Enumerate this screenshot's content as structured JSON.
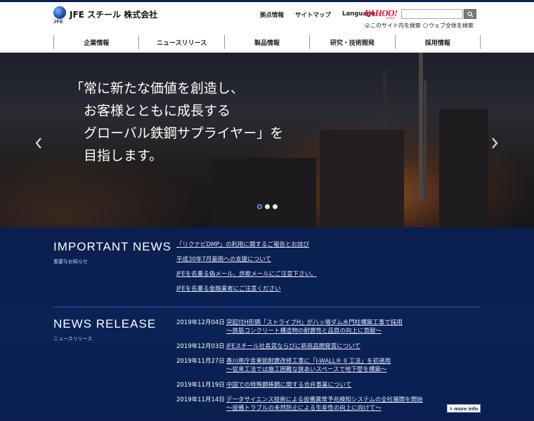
{
  "header": {
    "logo_text": "JFE",
    "company_name": "JFE スチール 株式会社",
    "util_links": [
      "拠点情報",
      "サイトマップ",
      "Language"
    ]
  },
  "search": {
    "yahoo_logo": "YAHOO!",
    "yahoo_sub": "JAPAN",
    "placeholder": "",
    "button_icon": "search-icon",
    "options": [
      "このサイト内を検索",
      "ウェブ全体を検索"
    ],
    "selected_option": "このサイト内を検索"
  },
  "nav": {
    "items": [
      "企業情報",
      "ニュースリリース",
      "製品情報",
      "研究・技術開発",
      "採用情報"
    ]
  },
  "hero": {
    "copy": "「常に新たな価値を創造し、\n　お客様とともに成長する\n　グローバル鉄鋼サプライヤー」を\n　目指します。",
    "slide_count": 3,
    "active_slide": 1
  },
  "important_news": {
    "title": "IMPORTANT NEWS",
    "subtitle": "重要なお知らせ",
    "items": [
      "「リクナビDMP」の利用に関するご報告とお詫び",
      "平成30年7月豪雨への支援について",
      "JFEを名乗る偽メール、詐欺メールにご注意下さい。",
      "JFEを名乗る金融業者にご注意ください"
    ]
  },
  "news_release": {
    "title": "NEWS RELEASE",
    "subtitle": "ニュースリリース",
    "items": [
      {
        "date": "2019年12月04日",
        "lines": [
          "突起付H形鋼「ストライプH」が八ッ場ダム水門柱構築工事で採用",
          "～鉄筋コンクリート構造物の耐震性と品質の向上に貢献～"
        ]
      },
      {
        "date": "2019年12月03日",
        "lines": [
          "JFEスチール社長賞ならびに新商品開発賞について"
        ]
      },
      {
        "date": "2019年11月27日",
        "lines": [
          "香川県庁舎東館耐震改修工事に「J-WALL® II 工法」を初適用",
          "～従来工法では施工困難な狭あいスペースで地下壁を構築～"
        ]
      },
      {
        "date": "2019年11月19日",
        "lines": [
          "中国での特殊鋼棒鋼に関する合弁事業について"
        ]
      },
      {
        "date": "2019年11月14日",
        "lines": [
          "データサイエンス技術による設備異常予兆検知システムの全社展開を開始",
          "～設備トラブルの未然防止による生産性の向上に向けて～"
        ]
      }
    ],
    "more_label": "> more info"
  },
  "colors": {
    "navy": "#0a1f4e",
    "yahoo_red": "#ff0033"
  }
}
